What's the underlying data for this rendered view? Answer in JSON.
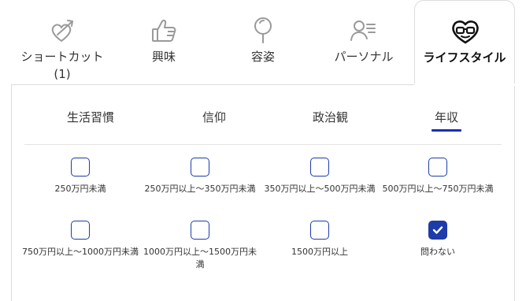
{
  "main_tabs": [
    {
      "label": "ショートカット\n(1)",
      "icon": "cupid-arrow-heart-icon"
    },
    {
      "label": "興味",
      "icon": "thumbs-up-icon"
    },
    {
      "label": "容姿",
      "icon": "hand-mirror-icon"
    },
    {
      "label": "パーソナル",
      "icon": "person-list-icon"
    },
    {
      "label": "ライフスタイル",
      "icon": "heart-glasses-icon",
      "active": true
    }
  ],
  "sub_tabs": [
    {
      "label": "生活習慣"
    },
    {
      "label": "信仰"
    },
    {
      "label": "政治観"
    },
    {
      "label": "年収",
      "active": true
    }
  ],
  "options": [
    {
      "label": "250万円未満",
      "checked": false
    },
    {
      "label": "250万円以上〜350万円未満",
      "checked": false
    },
    {
      "label": "350万円以上〜500万円未満",
      "checked": false
    },
    {
      "label": "500万円以上〜750万円未満",
      "checked": false
    },
    {
      "label": "750万円以上〜1000万円未満",
      "checked": false
    },
    {
      "label": "1000万円以上〜1500万円未満",
      "checked": false
    },
    {
      "label": "1500万円以上",
      "checked": false
    },
    {
      "label": "問わない",
      "checked": true
    }
  ],
  "colors": {
    "accent": "#1d3ca8",
    "underline": "#1a2fb8",
    "border": "#dcdcdc"
  }
}
